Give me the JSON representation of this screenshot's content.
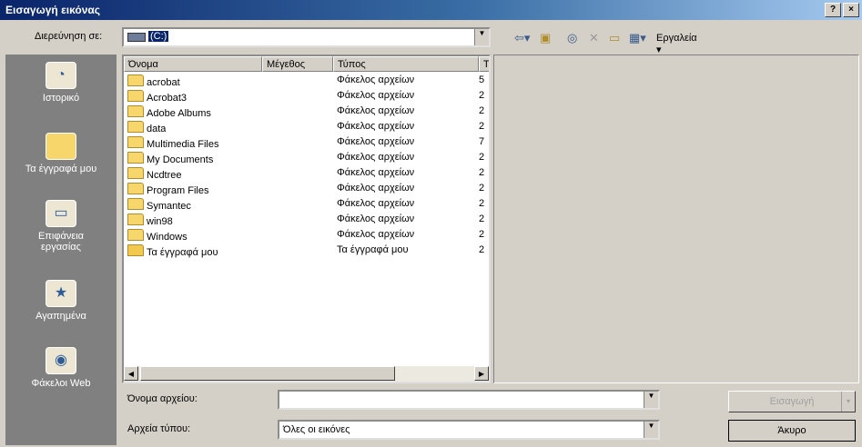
{
  "window": {
    "title": "Εισαγωγή εικόνας",
    "help_label": "?",
    "close_label": "×"
  },
  "lookin": {
    "label": "Διερεύνηση σε:",
    "value": "(C:)"
  },
  "toolbar": {
    "tools_label": "Εργαλεία"
  },
  "places": [
    {
      "label": "Ιστορικό",
      "icon": "history-icon"
    },
    {
      "label": "Τα έγγραφά μου",
      "icon": "my-documents-icon"
    },
    {
      "label": "Επιφάνεια εργασίας",
      "icon": "desktop-icon"
    },
    {
      "label": "Αγαπημένα",
      "icon": "favorites-icon"
    },
    {
      "label": "Φάκελοι Web",
      "icon": "web-folders-icon"
    }
  ],
  "columns": [
    "Όνομα",
    "Μέγεθος",
    "Τύπος",
    "Τ"
  ],
  "files": [
    {
      "name": "acrobat",
      "type": "Φάκελος αρχείων",
      "mod": "5"
    },
    {
      "name": "Acrobat3",
      "type": "Φάκελος αρχείων",
      "mod": "2"
    },
    {
      "name": "Adobe Albums",
      "type": "Φάκελος αρχείων",
      "mod": "2"
    },
    {
      "name": "data",
      "type": "Φάκελος αρχείων",
      "mod": "2"
    },
    {
      "name": "Multimedia Files",
      "type": "Φάκελος αρχείων",
      "mod": "7"
    },
    {
      "name": "My Documents",
      "type": "Φάκελος αρχείων",
      "mod": "2"
    },
    {
      "name": "Ncdtree",
      "type": "Φάκελος αρχείων",
      "mod": "2"
    },
    {
      "name": "Program Files",
      "type": "Φάκελος αρχείων",
      "mod": "2"
    },
    {
      "name": "Symantec",
      "type": "Φάκελος αρχείων",
      "mod": "2"
    },
    {
      "name": "win98",
      "type": "Φάκελος αρχείων",
      "mod": "2"
    },
    {
      "name": "Windows",
      "type": "Φάκελος αρχείων",
      "mod": "2"
    },
    {
      "name": "Τα έγγραφά μου",
      "type": "Τα έγγραφά μου",
      "mod": "2"
    }
  ],
  "filename": {
    "label": "Όνομα αρχείου:",
    "value": ""
  },
  "filetype": {
    "label": "Αρχεία τύπου:",
    "value": "Όλες οι εικόνες"
  },
  "buttons": {
    "insert": "Εισαγωγή",
    "cancel": "Άκυρο"
  }
}
